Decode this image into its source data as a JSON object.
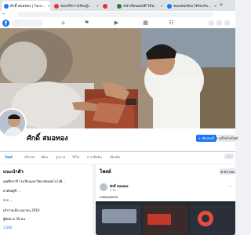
{
  "browser": {
    "tabs": [
      {
        "title": "ศักดิ์ สมอทอง | Facebook",
        "color": "#1877f2"
      },
      {
        "title": "ของจริงการเรียนรู้เพื่อ...",
        "color": "#e5332a"
      },
      {
        "title": "",
        "color": "#e5332a"
      },
      {
        "title": "หน้าเรียนสมบัติ ได้ทุกเรื่อง...",
        "color": "#2e7d32"
      },
      {
        "title": "ของเคยเรียน ได้รองรับด้วย...",
        "color": "#1877f2"
      }
    ],
    "new_tab": "+"
  },
  "profile": {
    "name": "ศักดิ์ สมอทอง",
    "actions": {
      "add_story": "เพิ่มสตอรี่",
      "edit_profile": "แก้ไขโปรไฟล์"
    },
    "tabs": [
      "โพสต์",
      "เกี่ยวกับ",
      "เพื่อน",
      "รูปภาพ",
      "วิดีโอ",
      "การเช็คอิน",
      "เพิ่มเติม"
    ]
  },
  "intro": {
    "title": "แนะนำตัว",
    "lines": [
      "เคยศึกษาที่ โรงเรียนมหาวิทยาลัยเทคโนโลยี...",
      "อาศัยอยู่ที่ ...",
      "จาก ...",
      "เข้าร่วมเมื่อ เมษายน 2014",
      "ผู้ติดตาม 39 คน"
    ],
    "followers": "1,000"
  },
  "posts": {
    "title": "โพสต์",
    "filter_label": "ตัวกรอง",
    "author": "ศักดิ์ สมอทอง",
    "meta": "1 วัน · ",
    "caption": "ลงของแต่งรถ"
  }
}
